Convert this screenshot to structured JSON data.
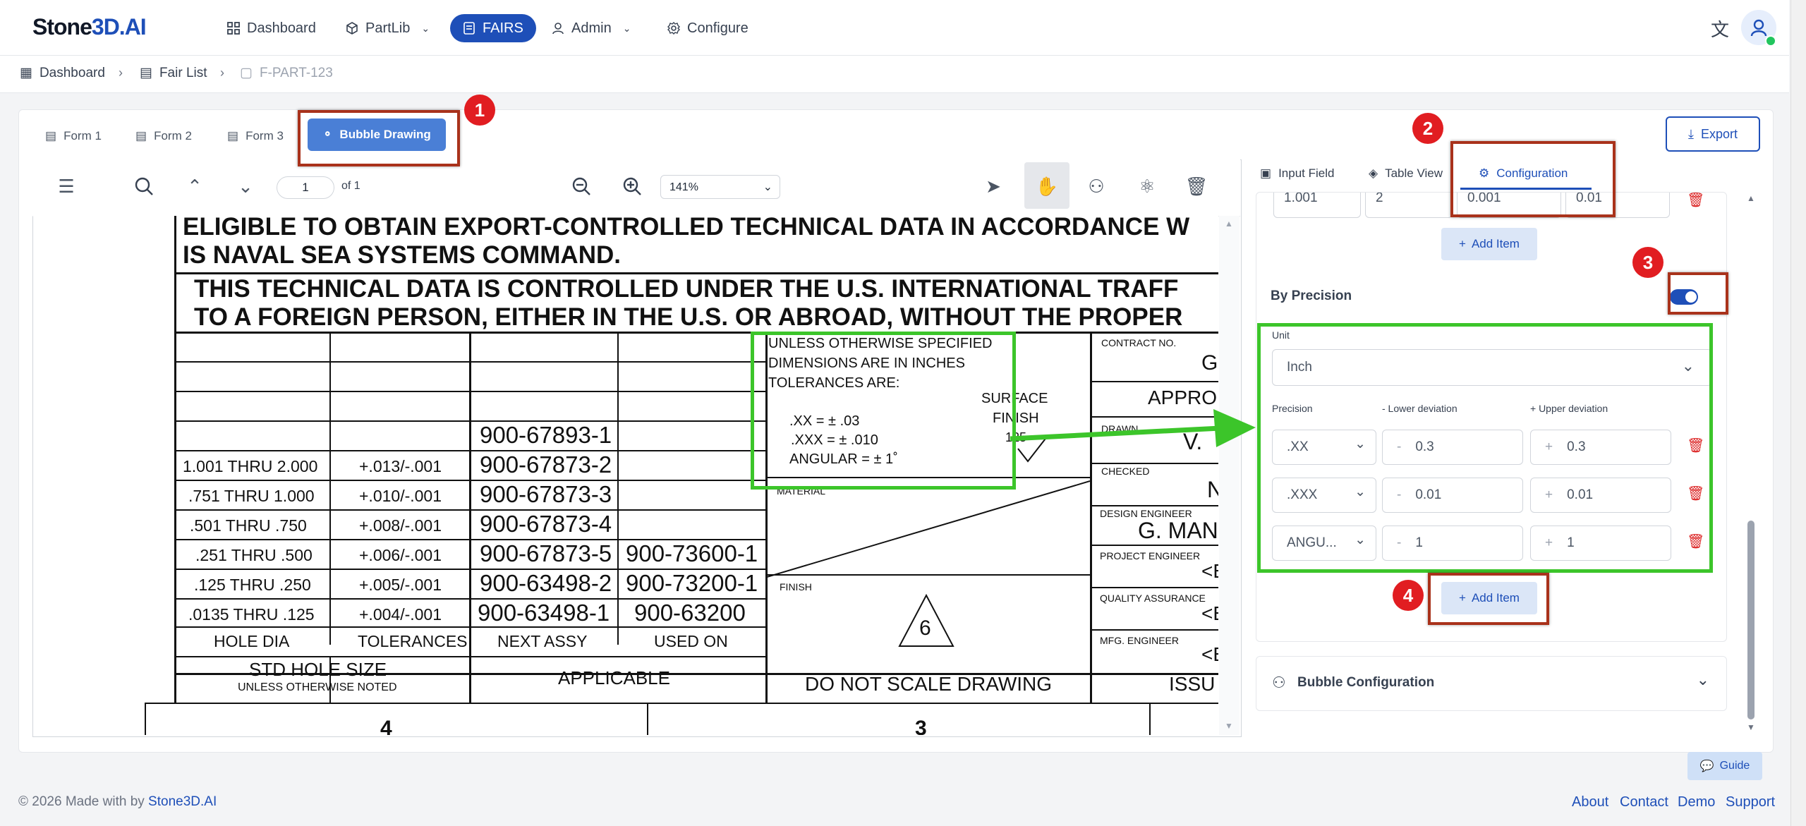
{
  "navbar": {
    "logo_prefix": "Stone",
    "logo_accent": "3D.AI",
    "items": [
      {
        "label": "Dashboard"
      },
      {
        "label": "PartLib"
      },
      {
        "label": "FAIRS"
      },
      {
        "label": "Admin"
      },
      {
        "label": "Configure"
      }
    ]
  },
  "breadcrumb": {
    "items": [
      {
        "label": "Dashboard"
      },
      {
        "label": "Fair List"
      },
      {
        "label": "F-PART-123"
      }
    ]
  },
  "form_tabs": [
    {
      "label": "Form 1"
    },
    {
      "label": "Form 2"
    },
    {
      "label": "Form 3"
    },
    {
      "label": "Bubble Drawing"
    }
  ],
  "export_label": "Export",
  "viewer": {
    "page_value": "1",
    "page_of": "of 1",
    "zoom": "141%"
  },
  "drawing": {
    "header1": "ELIGIBLE TO OBTAIN EXPORT-CONTROLLED TECHNICAL DATA IN ACCORDANCE W",
    "header2": "IS NAVAL SEA SYSTEMS COMMAND.",
    "header3": "THIS TECHNICAL DATA IS CONTROLLED UNDER THE U.S. INTERNATIONAL TRAFF",
    "header4": "TO A FOREIGN PERSON, EITHER IN THE U.S. OR ABROAD, WITHOUT THE PROPER",
    "rows": [
      {
        "dia": "",
        "tol": "",
        "next": "900-67893-1",
        "used": ""
      },
      {
        "dia": "1.001 THRU 2.000",
        "tol": "+.013/-.001",
        "next": "900-67873-2",
        "used": ""
      },
      {
        "dia": ".751 THRU 1.000",
        "tol": "+.010/-.001",
        "next": "900-67873-3",
        "used": ""
      },
      {
        "dia": ".501 THRU .750",
        "tol": "+.008/-.001",
        "next": "900-67873-4",
        "used": ""
      },
      {
        "dia": ".251 THRU .500",
        "tol": "+.006/-.001",
        "next": "900-67873-5",
        "used": "900-73600-1"
      },
      {
        "dia": ".125 THRU .250",
        "tol": "+.005/-.001",
        "next": "900-63498-2",
        "used": "900-73200-1"
      },
      {
        "dia": ".0135 THRU .125",
        "tol": "+.004/-.001",
        "next": "900-63498-1",
        "used": "900-63200"
      }
    ],
    "col_hole": "HOLE DIA",
    "col_tol": "TOLERANCES",
    "col_next": "NEXT ASSY",
    "col_used": "USED ON",
    "std_hole": "STD HOLE SIZE",
    "unless_noted": "UNLESS OTHERWISE NOTED",
    "applicable": "APPLICABLE",
    "unless1": "UNLESS OTHERWISE SPECIFIED",
    "unless2": "DIMENSIONS ARE IN INCHES",
    "unless3": "TOLERANCES ARE:",
    "tol_xx": ".XX = ± .03",
    "tol_xxx": ".XXX = ± .010",
    "tol_ang": "ANGULAR = ± 1˚",
    "surface": "SURFACE",
    "finish_label": "FINISH",
    "finish_val": "125",
    "material": "MATERIAL",
    "finish": "FINISH",
    "finish_num": "6",
    "do_not_scale": "DO NOT SCALE DRAWING",
    "contract": "CONTRACT NO.",
    "contract_val": "G",
    "appro": "APPRO",
    "drawn": "DRAWN",
    "drawn_val": "V.",
    "checked": "CHECKED",
    "checked_val": "N",
    "design_eng": "DESIGN ENGINEER",
    "design_val": "G. MAN",
    "project_eng": "PROJECT ENGINEER",
    "project_val": "<E",
    "qa": "QUALITY ASSURANCE",
    "qa_val": "<E",
    "mfg": "MFG. ENGINEER",
    "mfg_val": "<E",
    "issue": "ISSU",
    "bottom_4": "4",
    "bottom_3": "3"
  },
  "right_panel": {
    "tabs": [
      {
        "label": "Input Field"
      },
      {
        "label": "Table View"
      },
      {
        "label": "Configuration"
      }
    ],
    "top_row": {
      "a": "1.001",
      "b": "2",
      "c": "0.001",
      "d": "0.01"
    },
    "add_item_label": "Add Item",
    "by_precision": "By Precision",
    "unit_label": "Unit",
    "unit_value": "Inch",
    "col_precision": "Precision",
    "col_lower": "- Lower deviation",
    "col_upper": "+ Upper deviation",
    "precision_rows": [
      {
        "precision": ".XX",
        "lower": "0.3",
        "upper": "0.3"
      },
      {
        "precision": ".XXX",
        "lower": "0.01",
        "upper": "0.01"
      },
      {
        "precision": "ANGU...",
        "lower": "1",
        "upper": "1"
      }
    ],
    "bubble_config": "Bubble Configuration"
  },
  "badges": [
    "1",
    "2",
    "3",
    "4"
  ],
  "guide_label": "Guide",
  "footer": {
    "copyright": "© 2026 Made with by",
    "brand": "Stone3D.AI",
    "links": [
      {
        "label": "About"
      },
      {
        "label": "Contact"
      },
      {
        "label": "Demo"
      },
      {
        "label": "Support"
      }
    ]
  },
  "colors": {
    "primary": "#1e4fb8",
    "highlight_red": "#a9321b",
    "highlight_green": "#3cc52a",
    "badge_red": "#e11d21"
  }
}
